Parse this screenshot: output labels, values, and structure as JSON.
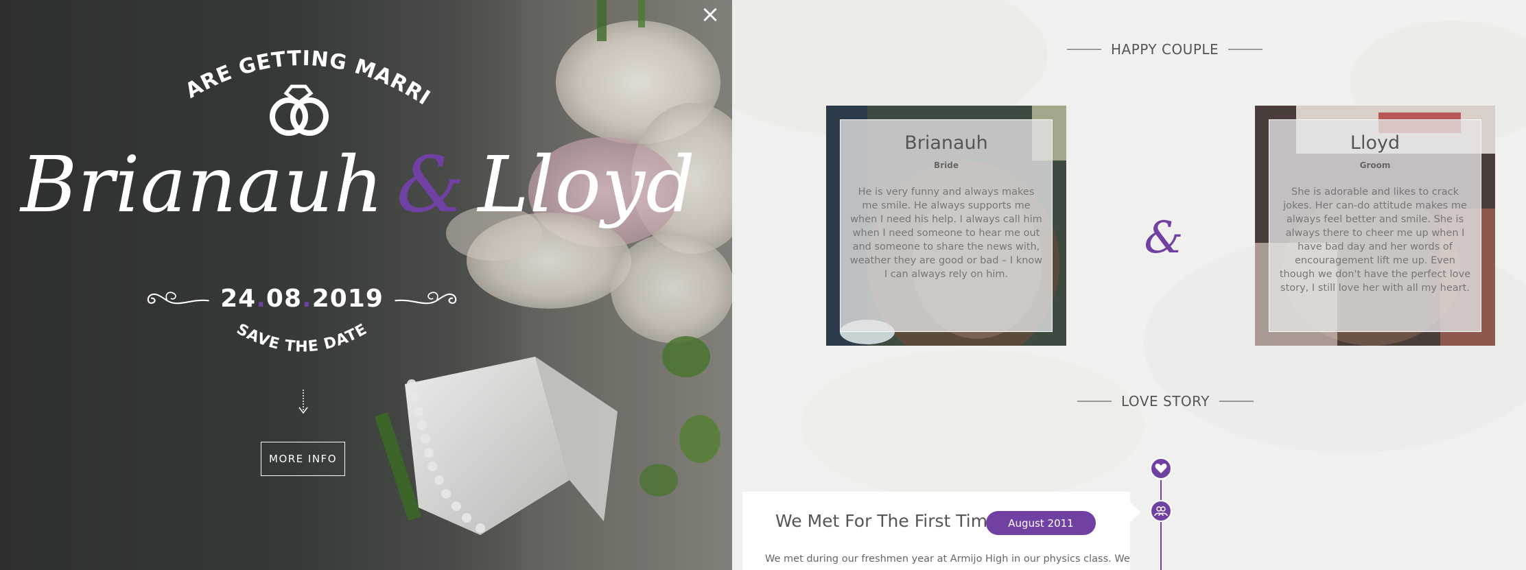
{
  "hero": {
    "arc_top": "WE ARE GETTING MARRIED",
    "name_left": "Brianauh",
    "ampersand": "&",
    "name_right": "Lloyd",
    "date_day": "24",
    "date_sep1": ".",
    "date_month": "08",
    "date_sep2": ".",
    "date_year": "2019",
    "arc_bottom": "SAVE THE DATE",
    "more_info": "MORE INFO",
    "close": "×",
    "icons": {
      "rings": "rings-icon",
      "arrow": "arrow-down-icon",
      "flourish": "flourish-ornament"
    }
  },
  "couple": {
    "title": "HAPPY COUPLE",
    "ampersand": "&",
    "bride": {
      "name": "Brianauh",
      "role": "Bride",
      "description": "He is very funny and always makes me smile. He always supports me when I need his help. I always call him when I need someone to hear me out and someone to share the news with, weather they are good or bad – I know I can always rely on him."
    },
    "groom": {
      "name": "Lloyd",
      "role": "Groom",
      "description": "She is adorable and likes to crack jokes. Her can-do attitude makes me always feel better and smile. She is always there to cheer me up when I have bad day and her words of encouragement lift me up. Even though we don't have the perfect love story, I still love her with all my heart."
    }
  },
  "story": {
    "title": "LOVE STORY",
    "items": [
      {
        "title": "We Met For The First Time",
        "date": "August 2011",
        "text": "We met during our freshmen year at Armijo High in our physics class. We",
        "icon": "heart-icon"
      }
    ],
    "second_icon": "couple-icon"
  },
  "colors": {
    "accent": "#7040a2",
    "hero_bg": "#2f322f",
    "content_bg": "#f0f0ee"
  }
}
